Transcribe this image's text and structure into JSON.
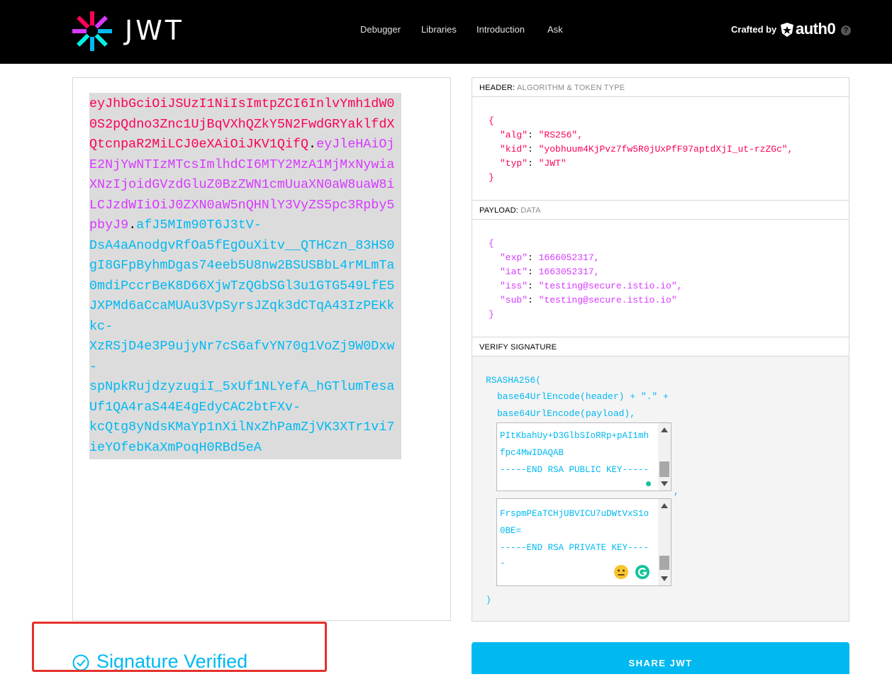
{
  "brand": {
    "wordmark": "JWT"
  },
  "nav": {
    "items": [
      {
        "label": "Debugger"
      },
      {
        "label": "Libraries"
      },
      {
        "label": "Introduction"
      },
      {
        "label": "Ask"
      }
    ],
    "crafted_by": "Crafted by",
    "auth0_label": "auth0",
    "help": "?"
  },
  "encoded": {
    "header_part": "eyJhbGciOiJSUzI1NiIsImtpZCI6InlvYmh1dW00S2pQdno3Znc1UjBqVXhQZkY5N2FwdGRYaklfdXQtcnpaR2MiLCJ0eXAiOiJKV1QifQ",
    "dot1": ".",
    "payload_part": "eyJleHAiOjE2NjYwNTIzMTcsImlhdCI6MTY2MzA1MjMxNywiaXNzIjoidGVzdGluZ0BzZWN1cmUuaXN0aW8uaW8iLCJzdWIiOiJ0ZXN0aW5nQHNlY3VyZS5pc3Rpby5pbyJ9",
    "dot2": ".",
    "signature_lines": [
      "afJ5MIm90T6J3tV-",
      "DsA4aAnodgvRfOa5fEgOuXitv__QTHCzn_83HS0",
      "gI8GFpByhmDgas74eeb5U8nw2BSUSBbL4rMLmTa",
      "0mdiPccrBeK8D66XjwTzQGbSGl3u1GTG549LfE5",
      "JXPMd6aCcaMUAu3VpSyrsJZqk3dCTqA43IzPEKk",
      "kc-",
      "XzRSjD4e3P9ujyNr7cS6afvYN70g1VoZj9W0Dxw",
      "-",
      "spNpkRujdzyzugiI_5xUf1NLYefA_hGTlumTesa",
      "Uf1QA4raS44E4gEdyCAC2btFXv-",
      "kcQtg8yNdsKMaYp1nXilNxZhPamZjVK3XTr1vi7",
      "ieYOfebKaXmPoqH0RBd5eA"
    ]
  },
  "header_section": {
    "title": "HEADER:",
    "subtitle": "ALGORITHM & TOKEN TYPE",
    "json": {
      "open": "{",
      "alg_key": "\"alg\"",
      "alg_val": "\"RS256\",",
      "kid_key": "\"kid\"",
      "kid_val": "\"yobhuum4KjPvz7fw5R0jUxPfF97aptdXjI_ut-rzZGc\",",
      "typ_key": "\"typ\"",
      "typ_val": "\"JWT\"",
      "close": "}"
    }
  },
  "payload_section": {
    "title": "PAYLOAD:",
    "subtitle": "DATA",
    "json": {
      "open": "{",
      "exp_key": "\"exp\"",
      "exp_val": "1666052317,",
      "iat_key": "\"iat\"",
      "iat_val": "1663052317,",
      "iss_key": "\"iss\"",
      "iss_val": "\"testing@secure.istio.io\",",
      "sub_key": "\"sub\"",
      "sub_val": "\"testing@secure.istio.io\"",
      "close": "}"
    }
  },
  "verify_section": {
    "title": "VERIFY SIGNATURE",
    "line1": "RSASHA256(",
    "line2": "base64UrlEncode(header) + \".\" +",
    "line3": "base64UrlEncode(payload),",
    "public_key_lines": [
      "PItKbahUy+D3GlbSIoRRp+pAI1mh",
      "fpc4MwIDAQAB",
      "-----END RSA PUBLIC KEY-----"
    ],
    "comma": ",",
    "private_key_lines": [
      "FrspmPEaTCHjUBVICU7uDWtVxS1o",
      "0BE=",
      "-----END RSA PRIVATE KEY----",
      "-"
    ],
    "close": ")"
  },
  "status": {
    "verified": "Signature Verified"
  },
  "share_button": "SHARE JWT",
  "colors": {
    "header_token": "#fb015b",
    "payload_token": "#d63aff",
    "signature_token": "#00b9f1",
    "highlight_box": "#e5302b"
  }
}
